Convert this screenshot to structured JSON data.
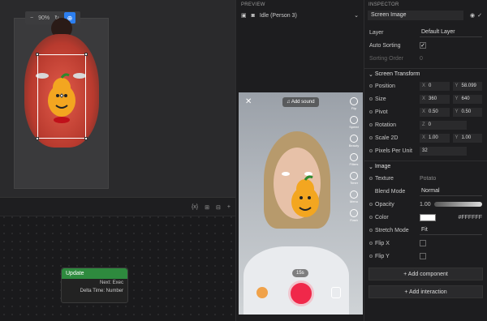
{
  "viewport": {
    "zoom_minus": "−",
    "zoom_level": "90%",
    "zoom_reset": "↻",
    "reset_icon": "crosshair-icon"
  },
  "graph": {
    "toolbar_var": "{x}",
    "node": {
      "title": "Update",
      "output_exec": "Next: Exec",
      "output_delta": "Delta Time: Number"
    }
  },
  "preview": {
    "header": "PREVIEW",
    "person_select": "Idle (Person 3)",
    "camera": {
      "add_sound": "Add sound",
      "timer": "15s",
      "side_items": [
        "Flip",
        "Speed",
        "Beauty",
        "Filters",
        "Timer",
        "Menu",
        "Flash"
      ]
    }
  },
  "inspector": {
    "header": "INSPECTOR",
    "object_name": "Screen Image",
    "layer_label": "Layer",
    "layer_value": "Default Layer",
    "auto_sorting_label": "Auto Sorting",
    "sorting_order_label": "Sorting Order",
    "sorting_order_value": "0",
    "screen_transform": {
      "title": "Screen Transform",
      "position": {
        "label": "Position",
        "x": "0",
        "y": "58.099"
      },
      "size": {
        "label": "Size",
        "x": "360",
        "y": "640"
      },
      "pivot": {
        "label": "Pivot",
        "x": "0.50",
        "y": "0.50"
      },
      "rotation": {
        "label": "Rotation",
        "z": "0"
      },
      "scale2d": {
        "label": "Scale 2D",
        "x": "1.00",
        "y": "1.00"
      },
      "ppu": {
        "label": "Pixels Per Unit",
        "value": "32"
      }
    },
    "image": {
      "title": "Image",
      "texture": {
        "label": "Texture",
        "value": "Potato"
      },
      "blend_mode": {
        "label": "Blend Mode",
        "value": "Normal"
      },
      "opacity": {
        "label": "Opacity",
        "value": "1.00"
      },
      "color": {
        "label": "Color",
        "value": "#FFFFFF"
      },
      "stretch_mode": {
        "label": "Stretch Mode",
        "value": "Fit"
      },
      "flip_x": {
        "label": "Flip X"
      },
      "flip_y": {
        "label": "Flip Y"
      }
    },
    "add_component": "+ Add component",
    "add_interaction": "+ Add interaction"
  }
}
